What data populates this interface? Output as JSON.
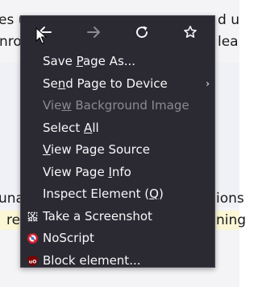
{
  "background": {
    "line1_text": "es u",
    "line1_right": "d u",
    "line2_text": "nro",
    "line2_right": "lea",
    "line3_text": "una",
    "line3_right": "ions",
    "line4_text": "re",
    "line4_right": "ning"
  },
  "menu": {
    "nav": [
      {
        "name": "back",
        "icon": "back-arrow-icon"
      },
      {
        "name": "forward",
        "icon": "forward-arrow-icon"
      },
      {
        "name": "reload",
        "icon": "reload-icon"
      },
      {
        "name": "bookmark",
        "icon": "star-icon"
      }
    ],
    "items": [
      {
        "label_before": "Save ",
        "accel": "P",
        "label_after": "age As...",
        "enabled": true
      },
      {
        "label_before": "Se",
        "accel": "n",
        "label_after": "d Page to Device",
        "enabled": true,
        "submenu": true
      },
      {
        "label_before": "Vie",
        "accel": "w",
        "label_after": " Background Image",
        "enabled": false
      },
      {
        "label_before": "Select ",
        "accel": "A",
        "label_after": "ll",
        "enabled": true
      },
      {
        "label_before": "",
        "accel": "V",
        "label_after": "iew Page Source",
        "enabled": true
      },
      {
        "label_before": "View Page ",
        "accel": "I",
        "label_after": "nfo",
        "enabled": true
      },
      {
        "label_before": "Inspect Element (",
        "accel": "Q",
        "label_after": ")",
        "enabled": true
      },
      {
        "label_before": "Take a Screenshot",
        "accel": "",
        "label_after": "",
        "enabled": true,
        "icon": "screenshot-icon"
      },
      {
        "label_before": "NoScript",
        "accel": "",
        "label_after": "",
        "enabled": true,
        "icon": "noscript-icon"
      },
      {
        "label_before": "Block element...",
        "accel": "",
        "label_after": "",
        "enabled": true,
        "icon": "ublock-icon"
      }
    ],
    "submenu_arrow": "›"
  }
}
